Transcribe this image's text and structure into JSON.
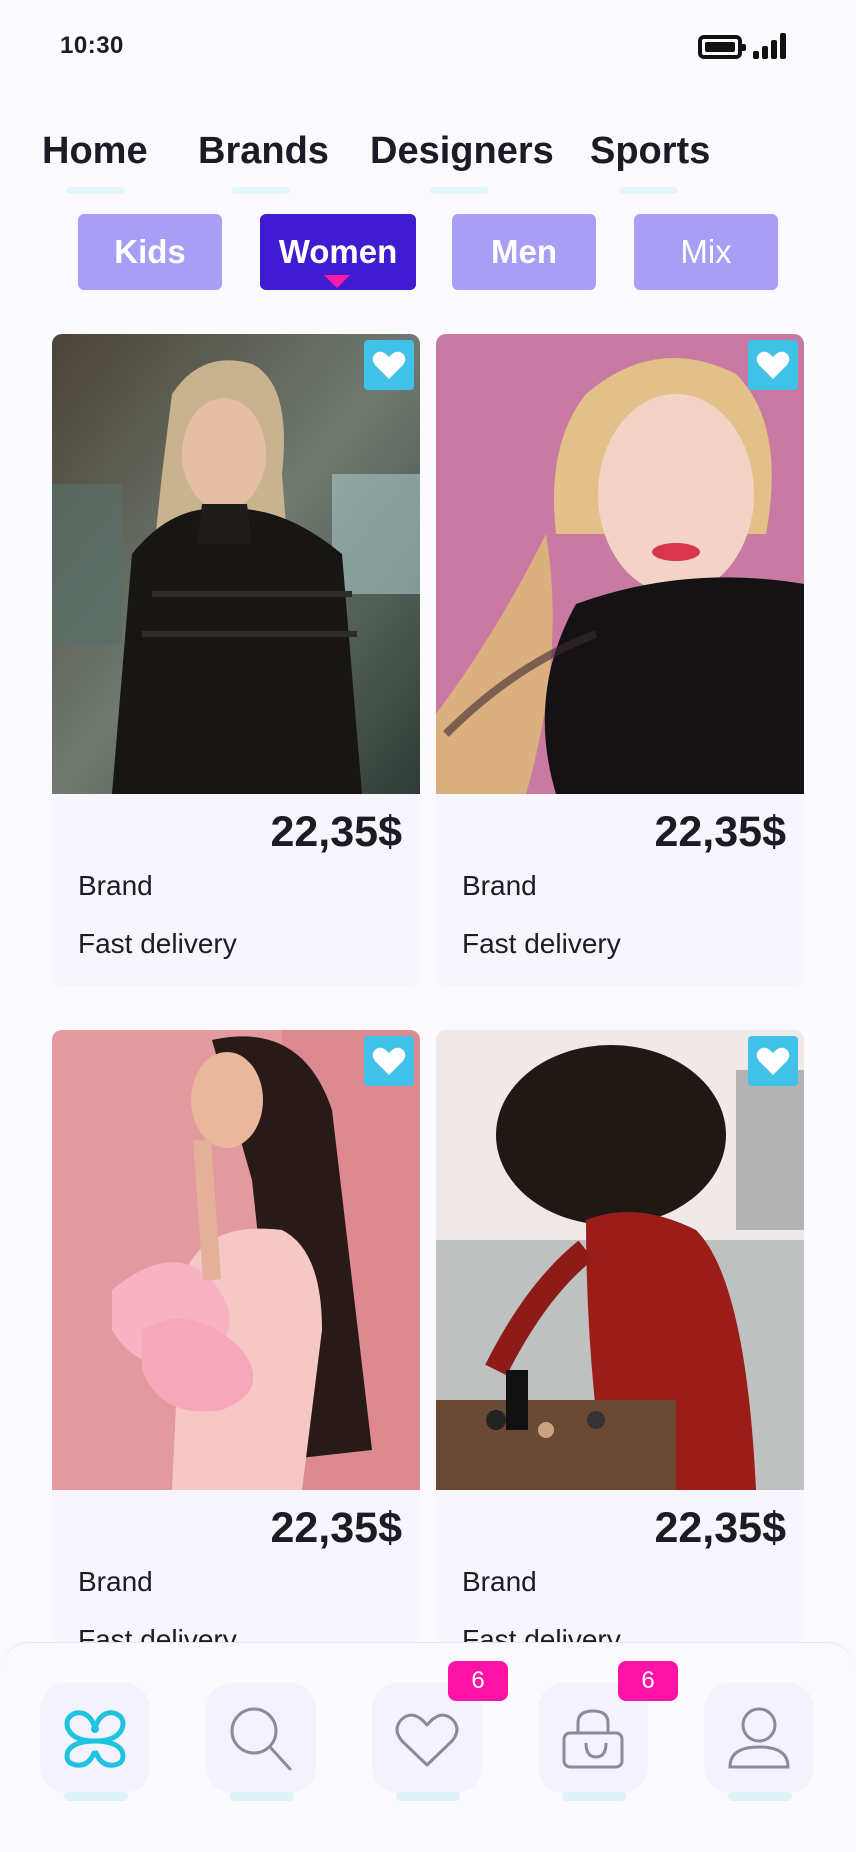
{
  "status_bar": {
    "time": "10:30",
    "battery_icon": "battery-icon",
    "signal_icon": "signal-icon"
  },
  "top_nav": [
    {
      "label": "Home"
    },
    {
      "label": "Brands"
    },
    {
      "label": "Designers"
    },
    {
      "label": "Sports"
    }
  ],
  "categories": [
    {
      "label": "Kids",
      "state": "default"
    },
    {
      "label": "Women",
      "state": "selected"
    },
    {
      "label": "Men",
      "state": "default"
    },
    {
      "label": "Mix",
      "state": "default"
    }
  ],
  "products": [
    {
      "price": "22,35$",
      "brand": "Brand",
      "delivery": "Fast delivery",
      "favorite_icon": "heart-icon"
    },
    {
      "price": "22,35$",
      "brand": "Brand",
      "delivery": "Fast delivery",
      "favorite_icon": "heart-icon"
    },
    {
      "price": "22,35$",
      "brand": "Brand",
      "delivery": "Fast delivery",
      "favorite_icon": "heart-icon"
    },
    {
      "price": "22,35$",
      "brand": "Brand",
      "delivery": "Fast delivery",
      "favorite_icon": "heart-icon"
    }
  ],
  "bottom_nav": {
    "tabs": [
      {
        "icon": "logo-icon"
      },
      {
        "icon": "search-icon"
      },
      {
        "icon": "heart-icon",
        "badge": "6"
      },
      {
        "icon": "shopping-bag-icon",
        "badge": "6"
      },
      {
        "icon": "profile-icon"
      }
    ]
  },
  "colors": {
    "accent": "#3f1bd1",
    "pill": "#a89ef5",
    "favorite": "#3fc1e8",
    "badge": "#ff12a6",
    "logo": "#1ec3e0"
  }
}
